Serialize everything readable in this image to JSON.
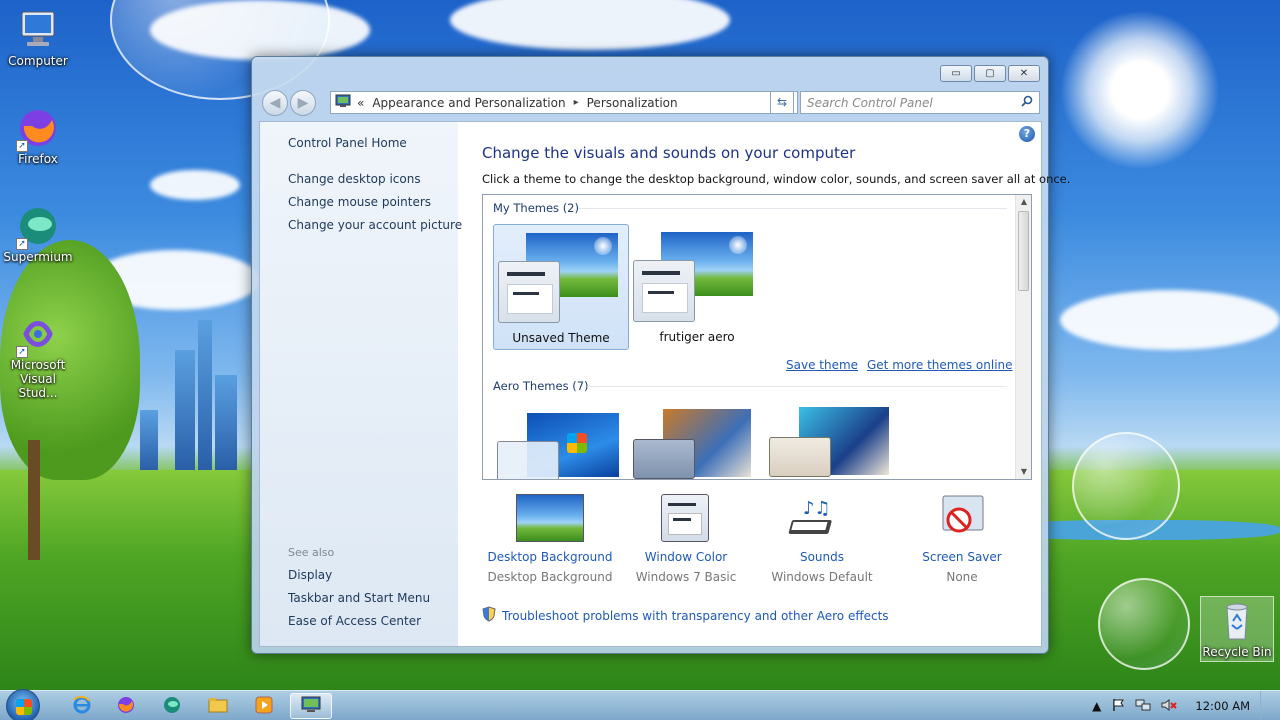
{
  "desktop": {
    "icons": [
      {
        "label": "Computer",
        "icon": "computer-icon"
      },
      {
        "label": "Firefox",
        "icon": "firefox-icon"
      },
      {
        "label": "Supermium",
        "icon": "supermium-icon"
      },
      {
        "label": "Microsoft Visual Stud...",
        "icon": "visual-studio-icon"
      },
      {
        "label": "Recycle Bin",
        "icon": "recycle-bin-icon"
      }
    ]
  },
  "window": {
    "caption_buttons": {
      "minimize": "▭",
      "maximize": "▢",
      "close": "✕"
    },
    "address": {
      "prefix": "«",
      "crumbs": [
        "Appearance and Personalization",
        "Personalization"
      ],
      "separator": "▸",
      "dropdown": "▾"
    },
    "search_placeholder": "Search Control Panel",
    "left_pane": {
      "home": "Control Panel Home",
      "links": [
        "Change desktop icons",
        "Change mouse pointers",
        "Change your account picture"
      ],
      "see_also_label": "See also",
      "see_also": [
        "Display",
        "Taskbar and Start Menu",
        "Ease of Access Center"
      ]
    },
    "main": {
      "title": "Change the visuals and sounds on your computer",
      "intro": "Click a theme to change the desktop background, window color, sounds, and screen saver all at once.",
      "my_themes_header": "My Themes (2)",
      "my_themes": [
        {
          "name": "Unsaved Theme",
          "selected": true
        },
        {
          "name": "frutiger aero",
          "selected": false
        }
      ],
      "save_theme": "Save theme",
      "get_more": "Get more themes online",
      "aero_header": "Aero Themes (7)",
      "tools": [
        {
          "name": "Desktop Background",
          "value": "Desktop Background",
          "icon": "desktop-background-icon"
        },
        {
          "name": "Window Color",
          "value": "Windows 7 Basic",
          "icon": "window-color-icon"
        },
        {
          "name": "Sounds",
          "value": "Windows Default",
          "icon": "sounds-icon"
        },
        {
          "name": "Screen Saver",
          "value": "None",
          "icon": "screen-saver-icon"
        }
      ],
      "troubleshoot": "Troubleshoot problems with transparency and other Aero effects"
    }
  },
  "taskbar": {
    "pinned": [
      "internet-explorer-icon",
      "firefox-icon",
      "supermium-icon",
      "file-explorer-icon",
      "media-player-icon",
      "control-panel-icon"
    ],
    "active": "control-panel-icon",
    "clock": "12:00 AM"
  },
  "colors": {
    "link": "#1e5ab5",
    "title": "#1e3287",
    "selection": "#cfe2f7"
  }
}
